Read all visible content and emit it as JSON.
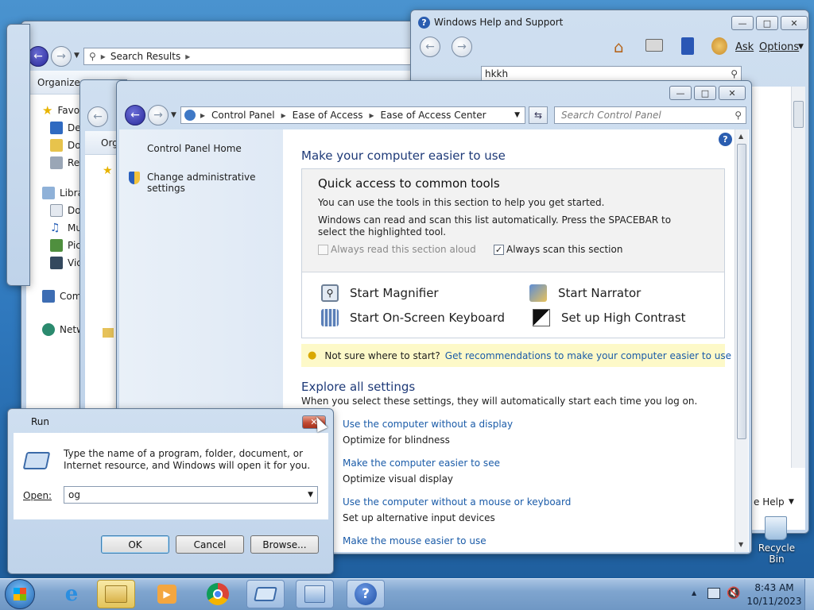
{
  "explorer_back": {
    "address": "Search Results",
    "toolbar_label": "Organize",
    "nav": [
      {
        "label": "Favo",
        "icon": "star-icon"
      },
      {
        "label": "Des",
        "icon": "desktop-icon"
      },
      {
        "label": "Dov",
        "icon": "downloads-icon"
      },
      {
        "label": "Rec",
        "icon": "recent-places-icon"
      },
      {
        "label": "Libra",
        "icon": "libraries-icon"
      },
      {
        "label": "Doc",
        "icon": "documents-icon"
      },
      {
        "label": "Mu",
        "icon": "music-icon"
      },
      {
        "label": "Pic",
        "icon": "pictures-icon"
      },
      {
        "label": "Vid",
        "icon": "videos-icon"
      },
      {
        "label": "Com",
        "icon": "computer-icon"
      },
      {
        "label": "Netw",
        "icon": "network-icon"
      }
    ]
  },
  "explorer_mid": {
    "toolbar_label": "Org"
  },
  "help": {
    "title": "Windows Help and Support",
    "search_value": "hkkh",
    "ask_label": "Ask",
    "options_label": "Options",
    "footer_help": "e Help"
  },
  "control_panel": {
    "address": {
      "crumbs": [
        "Control Panel",
        "Ease of Access",
        "Ease of Access Center"
      ]
    },
    "search_placeholder": "Search Control Panel",
    "sidebar": {
      "home": "Control Panel Home",
      "admin": "Change administrative settings"
    },
    "heading": "Make your computer easier to use",
    "quick": {
      "title": "Quick access to common tools",
      "line1": "You can use the tools in this section to help you get started.",
      "line2": "Windows can read and scan this list automatically.  Press the SPACEBAR to select the highlighted tool.",
      "read_aloud": "Always read this section aloud",
      "read_aloud_checked": false,
      "scan": "Always scan this section",
      "scan_checked": true,
      "tools": {
        "magnifier": "Start Magnifier",
        "narrator": "Start Narrator",
        "keyboard": "Start On-Screen Keyboard",
        "contrast": "Set up High Contrast"
      }
    },
    "tip": {
      "text": "Not sure where to start?",
      "link": "Get recommendations to make your computer easier to use"
    },
    "explore": {
      "title": "Explore all settings",
      "desc": "When you select these settings, they will automatically start each time you log on.",
      "items": [
        {
          "link": "Use the computer without a display",
          "desc": "Optimize for blindness"
        },
        {
          "link": "Make the computer easier to see",
          "desc": "Optimize visual display"
        },
        {
          "link": "Use the computer without a mouse or keyboard",
          "desc": "Set up alternative input devices"
        },
        {
          "link": "Make the mouse easier to use",
          "desc": ""
        }
      ]
    }
  },
  "run": {
    "title": "Run",
    "desc": "Type the name of a program, folder, document, or Internet resource, and Windows will open it for you.",
    "open_label": "Open:",
    "open_value": "og",
    "ok": "OK",
    "cancel": "Cancel",
    "browse": "Browse..."
  },
  "desktop": {
    "recycle_bin": "Recycle Bin"
  },
  "taskbar": {
    "time": "8:43 AM",
    "date": "10/11/2023"
  },
  "colors": {
    "link": "#1a5ba8",
    "heading": "#1e3a78",
    "tip_bg": "#fdf9c8"
  }
}
